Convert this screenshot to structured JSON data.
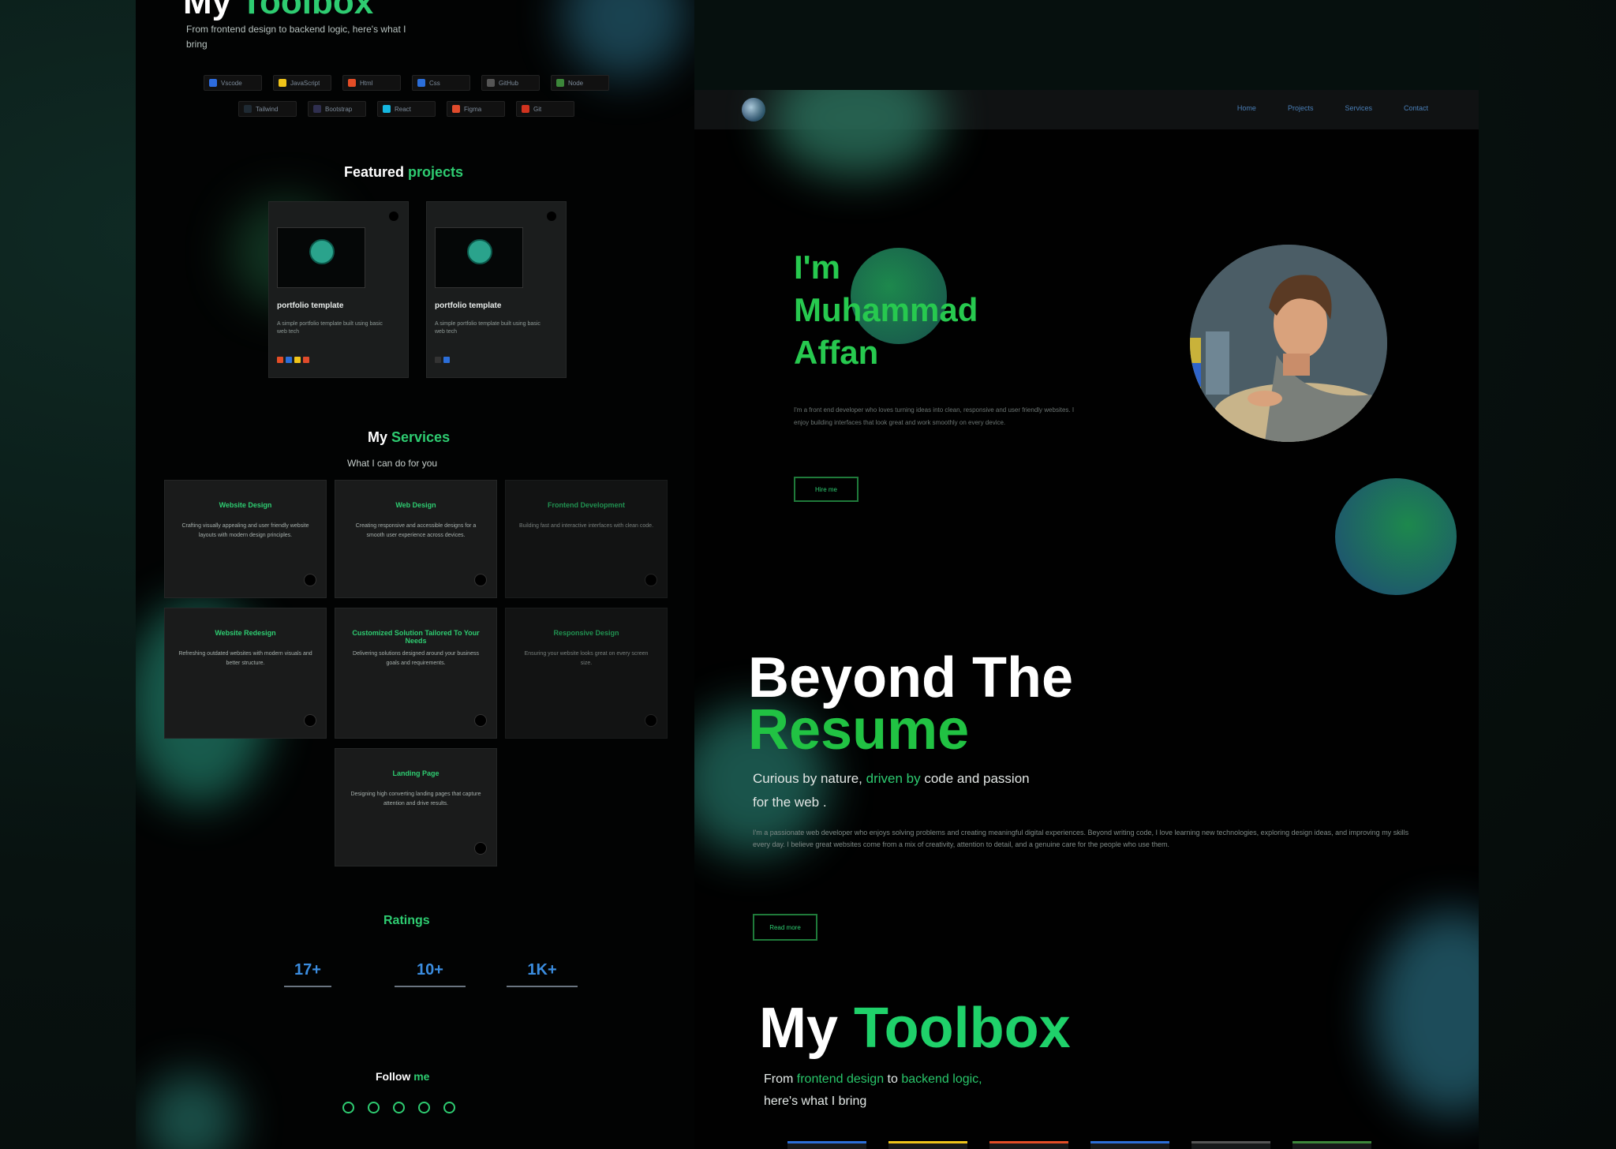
{
  "left_panel": {
    "toolbox": {
      "title_plain": "My ",
      "title_accent": "Toolbox",
      "subtitle": "From frontend design to backend logic, here's what I bring"
    },
    "chips_row1": [
      {
        "label": "Vscode",
        "color": "#2d6cdf"
      },
      {
        "label": "JavaScript",
        "color": "#f0c419"
      },
      {
        "label": "Html",
        "color": "#e44d26"
      },
      {
        "label": "Css",
        "color": "#2b6ed9"
      },
      {
        "label": "GitHub",
        "color": "#555555"
      },
      {
        "label": "Node",
        "color": "#3c873a"
      }
    ],
    "chips_row2": [
      {
        "label": "Tailwind",
        "color": "#1f2a33"
      },
      {
        "label": "Bootstrap",
        "color": "#2f2f4f"
      },
      {
        "label": "React",
        "color": "#15b7e0"
      },
      {
        "label": "Figma",
        "color": "#e04b2c"
      },
      {
        "label": "Git",
        "color": "#d1331f"
      }
    ],
    "featured": {
      "plain": "Featured ",
      "accent": "projects",
      "cards": [
        {
          "title": "portfolio template",
          "desc": "A simple portfolio template built using basic web tech",
          "tags": [
            "#e44d26",
            "#2b6ed9",
            "#f0c419",
            "#e04b2c"
          ]
        },
        {
          "title": "portfolio template",
          "desc": "A simple portfolio template built using basic web tech",
          "tags": [
            "#333333",
            "#2b6ed9"
          ]
        }
      ]
    },
    "services": {
      "plain": "My ",
      "accent": "Services",
      "subtitle": "What I can do for you",
      "cards": [
        {
          "title": "Website Design",
          "desc": "Crafting visually appealing and user friendly website layouts with modern design principles."
        },
        {
          "title": "Web Design",
          "desc": "Creating responsive and accessible designs for a smooth user experience across devices."
        },
        {
          "title": "Frontend Development",
          "desc": "Building fast and interactive interfaces with clean code."
        },
        {
          "title": "Website Redesign",
          "desc": "Refreshing outdated websites with modern visuals and better structure."
        },
        {
          "title": "Customized Solution Tailored To Your Needs",
          "desc": "Delivering solutions designed around your business goals and requirements."
        },
        {
          "title": "Responsive Design",
          "desc": "Ensuring your website looks great on every screen size."
        },
        {
          "title": "Landing Page",
          "desc": "Designing high converting landing pages that capture attention and drive results."
        }
      ]
    },
    "ratings": {
      "heading": "Ratings",
      "stats": [
        "17+",
        "10+",
        "1K+"
      ]
    },
    "follow": {
      "plain": "Follow ",
      "accent": "me"
    }
  },
  "right_panel": {
    "nav": [
      "Home",
      "Projects",
      "Services",
      "Contact"
    ],
    "hero": {
      "line1": "I'm",
      "line2": "Muhammad",
      "line3": "Affan",
      "body": "I'm a front end developer who loves turning ideas into clean, responsive and user friendly websites. I enjoy building interfaces that look great and work smoothly on every device.",
      "button": "Hire me"
    },
    "beyond": {
      "line1": "Beyond The",
      "line2": "Resume",
      "sub_plain_1": "Curious by nature, ",
      "sub_accent": "driven by",
      "sub_plain_2": " code and passion",
      "sub_line2": "for the web .",
      "body": "I'm a passionate web developer who enjoys solving problems and creating meaningful digital experiences. Beyond writing code, I love learning new technologies, exploring design ideas, and improving my skills every day. I believe great websites come from a mix of creativity, attention to detail, and a genuine care for the people who use them.",
      "button": "Read more"
    },
    "toolbox": {
      "title_plain": "My ",
      "title_accent": "Toolbox",
      "sub_plain_1": "From ",
      "sub_accent_1": "frontend design",
      "sub_plain_2": " to ",
      "sub_accent_2": "backend logic,",
      "sub_line2": "here's what I bring"
    },
    "bottom_chip_colors": [
      "#2b6ed9",
      "#f0c419",
      "#e44d26",
      "#2b6ed9",
      "#555555",
      "#3c873a"
    ]
  }
}
